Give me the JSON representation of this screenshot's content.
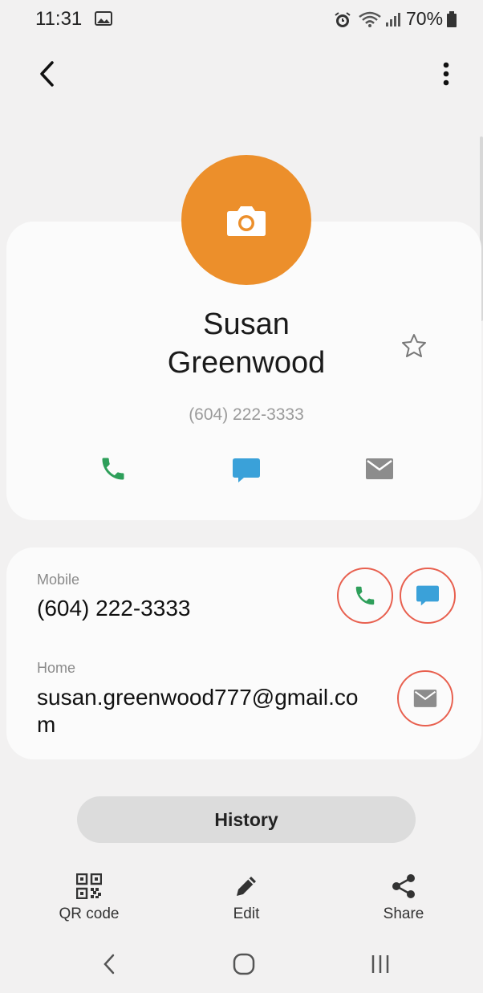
{
  "status_bar": {
    "time": "11:31",
    "battery_percent": "70%",
    "icons": [
      "image-icon",
      "alarm-icon",
      "wifi-icon",
      "signal-icon",
      "battery-icon"
    ]
  },
  "top_bar": {
    "icons": [
      "back-arrow-icon",
      "more-vertical-icon"
    ]
  },
  "profile": {
    "name_first": "Susan",
    "name_last": "Greenwood",
    "primary_phone": "(604) 222-3333",
    "avatar_icon": "camera-icon",
    "avatar_color": "#ec8f2b",
    "favorite_icon": "star-outline-icon",
    "quick_actions": [
      "phone-icon",
      "message-icon",
      "email-icon"
    ]
  },
  "details": {
    "mobile_label": "Mobile",
    "mobile_value": "(604) 222-3333",
    "home_label": "Home",
    "home_value": "susan.greenwood777@gmail.com",
    "highlight_color": "#e8604f"
  },
  "history_button": "History",
  "bottom_actions": {
    "qr": "QR code",
    "edit": "Edit",
    "share": "Share"
  },
  "nav_bar": [
    "back-icon",
    "home-icon",
    "recents-icon"
  ],
  "colors": {
    "call_green": "#2e9f5a",
    "message_blue": "#3aa1d9",
    "email_gray": "#8c8c8c"
  }
}
